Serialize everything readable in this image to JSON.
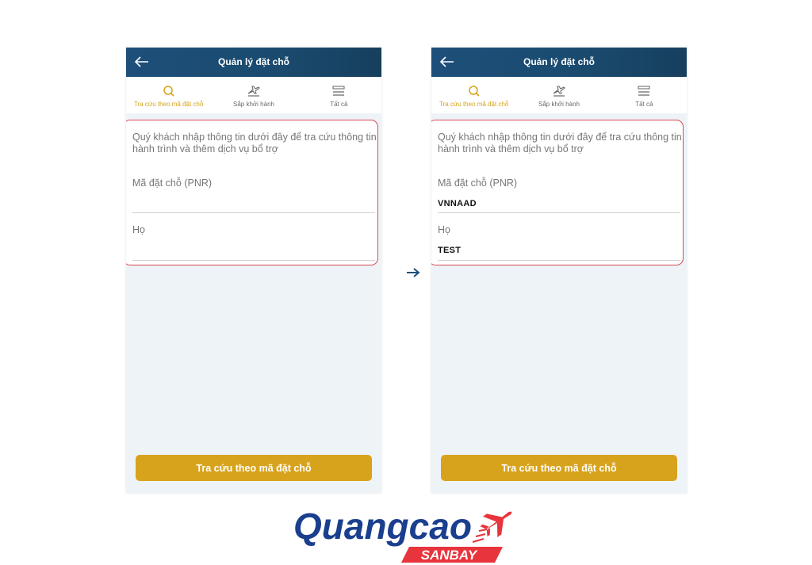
{
  "colors": {
    "header_bg": "#1d4f7a",
    "accent_gold": "#d8a31c",
    "highlight_border": "#d84a55",
    "logo_blue": "#1b3f8f",
    "logo_red": "#e8343c"
  },
  "screens": [
    {
      "header": {
        "back_icon": "arrow-left-icon",
        "title": "Quản lý đặt chỗ"
      },
      "tabs": [
        {
          "label": "Tra cứu theo mã đặt chỗ",
          "icon": "search-icon",
          "active": true
        },
        {
          "label": "Sắp khởi hành",
          "icon": "plane-departure-icon",
          "active": false
        },
        {
          "label": "Tất cả",
          "icon": "list-icon",
          "active": false
        }
      ],
      "form": {
        "intro": "Quý khách nhập thông tin dưới đây để tra cứu thông tin hành trình và thêm dịch vụ bổ trợ",
        "pnr_label": "Mã đặt chỗ (PNR)",
        "pnr_value": "",
        "surname_label": "Họ",
        "surname_value": ""
      },
      "submit_label": "Tra cứu theo mã đặt chỗ"
    },
    {
      "header": {
        "back_icon": "arrow-left-icon",
        "title": "Quản lý đặt chỗ"
      },
      "tabs": [
        {
          "label": "Tra cứu theo mã đặt chỗ",
          "icon": "search-icon",
          "active": true
        },
        {
          "label": "Sắp khởi hành",
          "icon": "plane-departure-icon",
          "active": false
        },
        {
          "label": "Tất cả",
          "icon": "list-icon",
          "active": false
        }
      ],
      "form": {
        "intro": "Quý khách nhập thông tin dưới đây để tra cứu thông tin hành trình và thêm dịch vụ bổ trợ",
        "pnr_label": "Mã đặt chỗ (PNR)",
        "pnr_value": "VNNAAD",
        "surname_label": "Họ",
        "surname_value": "TEST"
      },
      "submit_label": "Tra cứu theo mã đặt chỗ"
    }
  ],
  "transition_icon": "arrow-right-icon",
  "logo": {
    "main": "Quangcao",
    "sub": "SANBAY",
    "icon": "airplane-icon"
  }
}
